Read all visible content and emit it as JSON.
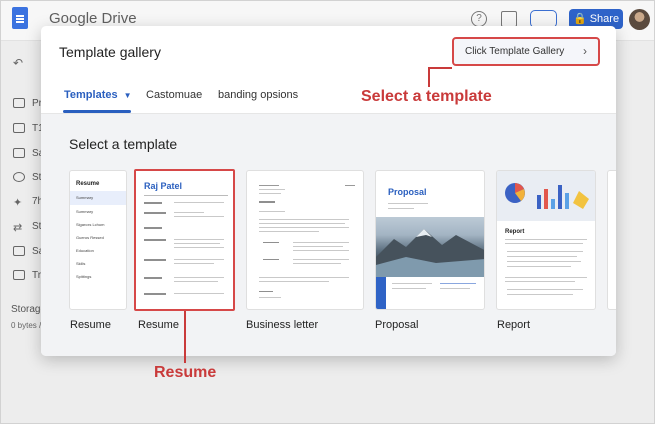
{
  "app": {
    "title": "Google Drive",
    "share_label": "Share",
    "sidebar_truncated": [
      "Pr",
      "T1",
      "Sa",
      "St",
      "7h",
      "St",
      "Sa",
      "Tr"
    ],
    "storage_label": "Storage",
    "storage_value": "0 bytes /"
  },
  "modal": {
    "title": "Template gallery",
    "cta_label": "Click Template Gallery",
    "cta_chevron": "›",
    "tabs": [
      {
        "label": "Templates"
      },
      {
        "label": "Castomuae"
      },
      {
        "label": "banding opsions"
      }
    ],
    "section_title": "Select a template",
    "cards": [
      {
        "label": "Resume",
        "thumb_heading": "Resume",
        "thumb_items": [
          "Summary",
          "Summary",
          "Sigarcxs Lchum",
          "Gueros Ressed",
          "Education",
          "Skills",
          "Spittings"
        ]
      },
      {
        "label": "Resume",
        "thumb_heading": "Raj Patel"
      },
      {
        "label": "Business letter"
      },
      {
        "label": "Proposal",
        "thumb_heading": "Proposal"
      },
      {
        "label": "Report",
        "thumb_heading": "Report"
      }
    ]
  },
  "annotations": {
    "select_template": "Select a template",
    "resume": "Resume"
  },
  "colors": {
    "accent": "#2a5fbf",
    "annotation": "#c93a3a",
    "share": "#2e63c9"
  }
}
